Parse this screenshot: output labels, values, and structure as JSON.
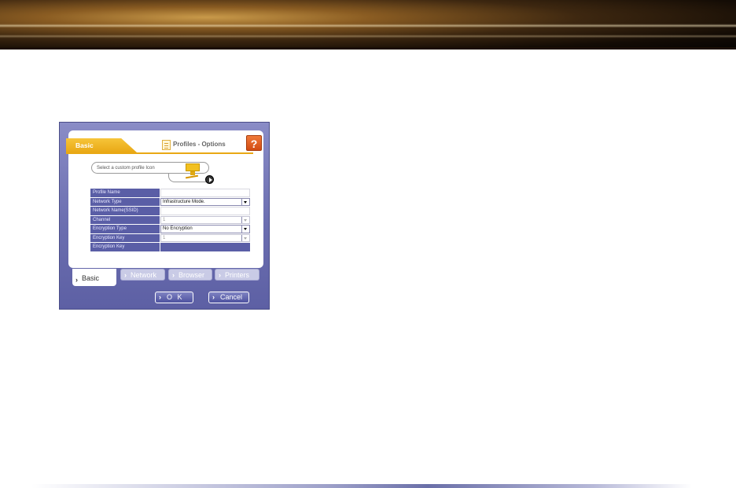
{
  "dialog": {
    "header_label": "Basic",
    "title": "Profiles - Options",
    "help_label": "?",
    "icon_prompt": "Select a custom profile Icon",
    "fields": [
      {
        "label": "Profile Name",
        "value": ""
      },
      {
        "label": "Network Type",
        "value": "Infrastructure Mode."
      },
      {
        "label": "Network Name(SSID)",
        "value": ""
      },
      {
        "label": "Channel",
        "value": "1"
      },
      {
        "label": "Encryption Type",
        "value": "No Encryption"
      },
      {
        "label": "Encryption Key",
        "value": "1"
      },
      {
        "label": "Encryption Key",
        "value": ""
      }
    ],
    "tabs": {
      "basic": "Basic",
      "network": "Network",
      "browser": "Browser",
      "printers": "Printers"
    },
    "buttons": {
      "ok": "O K",
      "cancel": "Cancel"
    }
  },
  "colors": {
    "frame": "#6b6eb0",
    "accent": "#e9a814",
    "help": "#d24b12"
  }
}
